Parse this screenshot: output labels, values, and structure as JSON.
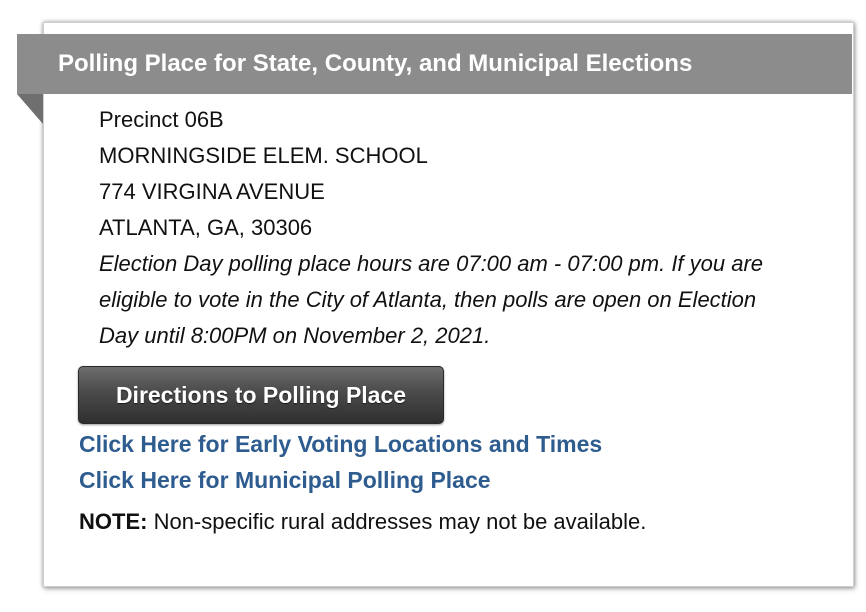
{
  "header": {
    "title": "Polling Place for State, County, and Municipal Elections"
  },
  "polling_place": {
    "precinct": "Precinct 06B",
    "location_name": "MORNINGSIDE ELEM. SCHOOL",
    "street": "774 VIRGINA AVENUE",
    "city_state_zip": "ATLANTA, GA, 30306",
    "hours_note": "Election Day polling place hours are 07:00 am - 07:00 pm. If you are eligible to vote in the City of Atlanta, then polls are open on Election Day until 8:00PM on November 2, 2021."
  },
  "actions": {
    "directions_button": "Directions to Polling Place",
    "early_voting_link": "Click Here for Early Voting Locations and Times",
    "municipal_link": "Click Here for Municipal Polling Place"
  },
  "note": {
    "label": "NOTE:",
    "text": " Non-specific rural addresses may not be available."
  },
  "colors": {
    "ribbon": "#8c8c8c",
    "link": "#2e5c8f",
    "button": "#3c3c3c"
  }
}
